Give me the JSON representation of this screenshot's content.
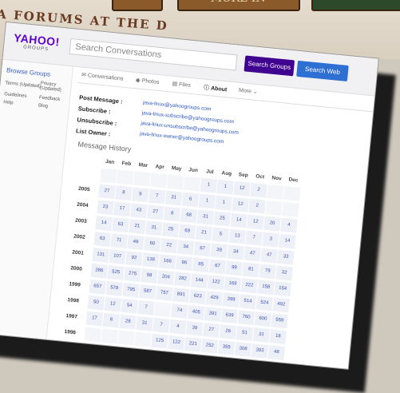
{
  "background": {
    "banner_text": "A FORUMS AT THE D",
    "signs": [
      "",
      "MORE IN",
      ""
    ]
  },
  "header": {
    "logo_text": "YAHOO!",
    "logo_sub": "GROUPS",
    "search_placeholder": "Search Conversations",
    "search_groups_label": "Search Groups",
    "search_web_label": "Search Web"
  },
  "sidebar": {
    "title": "Browse Groups",
    "links": [
      "Terms (Updated)",
      "Privacy (Updated)",
      "Guidelines",
      "Feedback",
      "Help",
      "Blog"
    ]
  },
  "tabs": [
    {
      "label": "Conversations",
      "icon": "chat-icon",
      "active": false
    },
    {
      "label": "Photos",
      "icon": "camera-icon",
      "active": false
    },
    {
      "label": "Files",
      "icon": "folder-icon",
      "active": false
    },
    {
      "label": "About",
      "icon": "info-icon",
      "active": true
    },
    {
      "label": "More",
      "icon": "chevron-down-icon",
      "active": false
    }
  ],
  "info": [
    {
      "label": "Post Message :",
      "value": "java-linux@yahoogroups.com"
    },
    {
      "label": "Subscribe :",
      "value": "java-linux-subscribe@yahoogroups.com"
    },
    {
      "label": "Unsubscribe :",
      "value": "java-linux-unsubscribe@yahoogroups.com"
    },
    {
      "label": "List Owner :",
      "value": "java-linux-owner@yahoogroups.com"
    }
  ],
  "history": {
    "title": "Message History",
    "months": [
      "Jan",
      "Feb",
      "Mar",
      "Apr",
      "May",
      "Jun",
      "Jul",
      "Aug",
      "Sep",
      "Oct",
      "Nov",
      "Dec"
    ],
    "rows": [
      {
        "year": "",
        "values": [
          "",
          "",
          "",
          "",
          "",
          "",
          "1",
          "1",
          "12",
          "2",
          "",
          ""
        ]
      },
      {
        "year": "2005",
        "values": [
          "27",
          "8",
          "9",
          "7",
          "31",
          "6",
          "1",
          "1",
          "12",
          "2",
          "",
          ""
        ]
      },
      {
        "year": "2004",
        "values": [
          "23",
          "17",
          "43",
          "27",
          "8",
          "68",
          "31",
          "25",
          "14",
          "12",
          "20",
          "4"
        ]
      },
      {
        "year": "2003",
        "values": [
          "14",
          "63",
          "21",
          "31",
          "25",
          "69",
          "21",
          "5",
          "13",
          "7",
          "3",
          "14"
        ]
      },
      {
        "year": "2002",
        "values": [
          "63",
          "71",
          "49",
          "60",
          "22",
          "34",
          "67",
          "39",
          "34",
          "47",
          "47",
          "33"
        ]
      },
      {
        "year": "2001",
        "values": [
          "131",
          "107",
          "92",
          "138",
          "166",
          "96",
          "85",
          "67",
          "99",
          "81",
          "79",
          "32"
        ]
      },
      {
        "year": "2000",
        "values": [
          "386",
          "525",
          "275",
          "98",
          "204",
          "282",
          "144",
          "122",
          "169",
          "222",
          "158",
          "154"
        ]
      },
      {
        "year": "1999",
        "values": [
          "657",
          "578",
          "795",
          "587",
          "757",
          "891",
          "623",
          "429",
          "399",
          "514",
          "524",
          "492"
        ]
      },
      {
        "year": "1998",
        "values": [
          "50",
          "12",
          "54",
          "7",
          "",
          "74",
          "405",
          "391",
          "639",
          "760",
          "600",
          "559"
        ]
      },
      {
        "year": "1997",
        "values": [
          "17",
          "8",
          "28",
          "31",
          "7",
          "4",
          "39",
          "27",
          "26",
          "51",
          "31",
          "18"
        ]
      },
      {
        "year": "1996",
        "values": [
          "",
          "",
          "",
          "",
          "125",
          "122",
          "221",
          "252",
          "355",
          "308",
          "393",
          "48"
        ]
      }
    ]
  }
}
